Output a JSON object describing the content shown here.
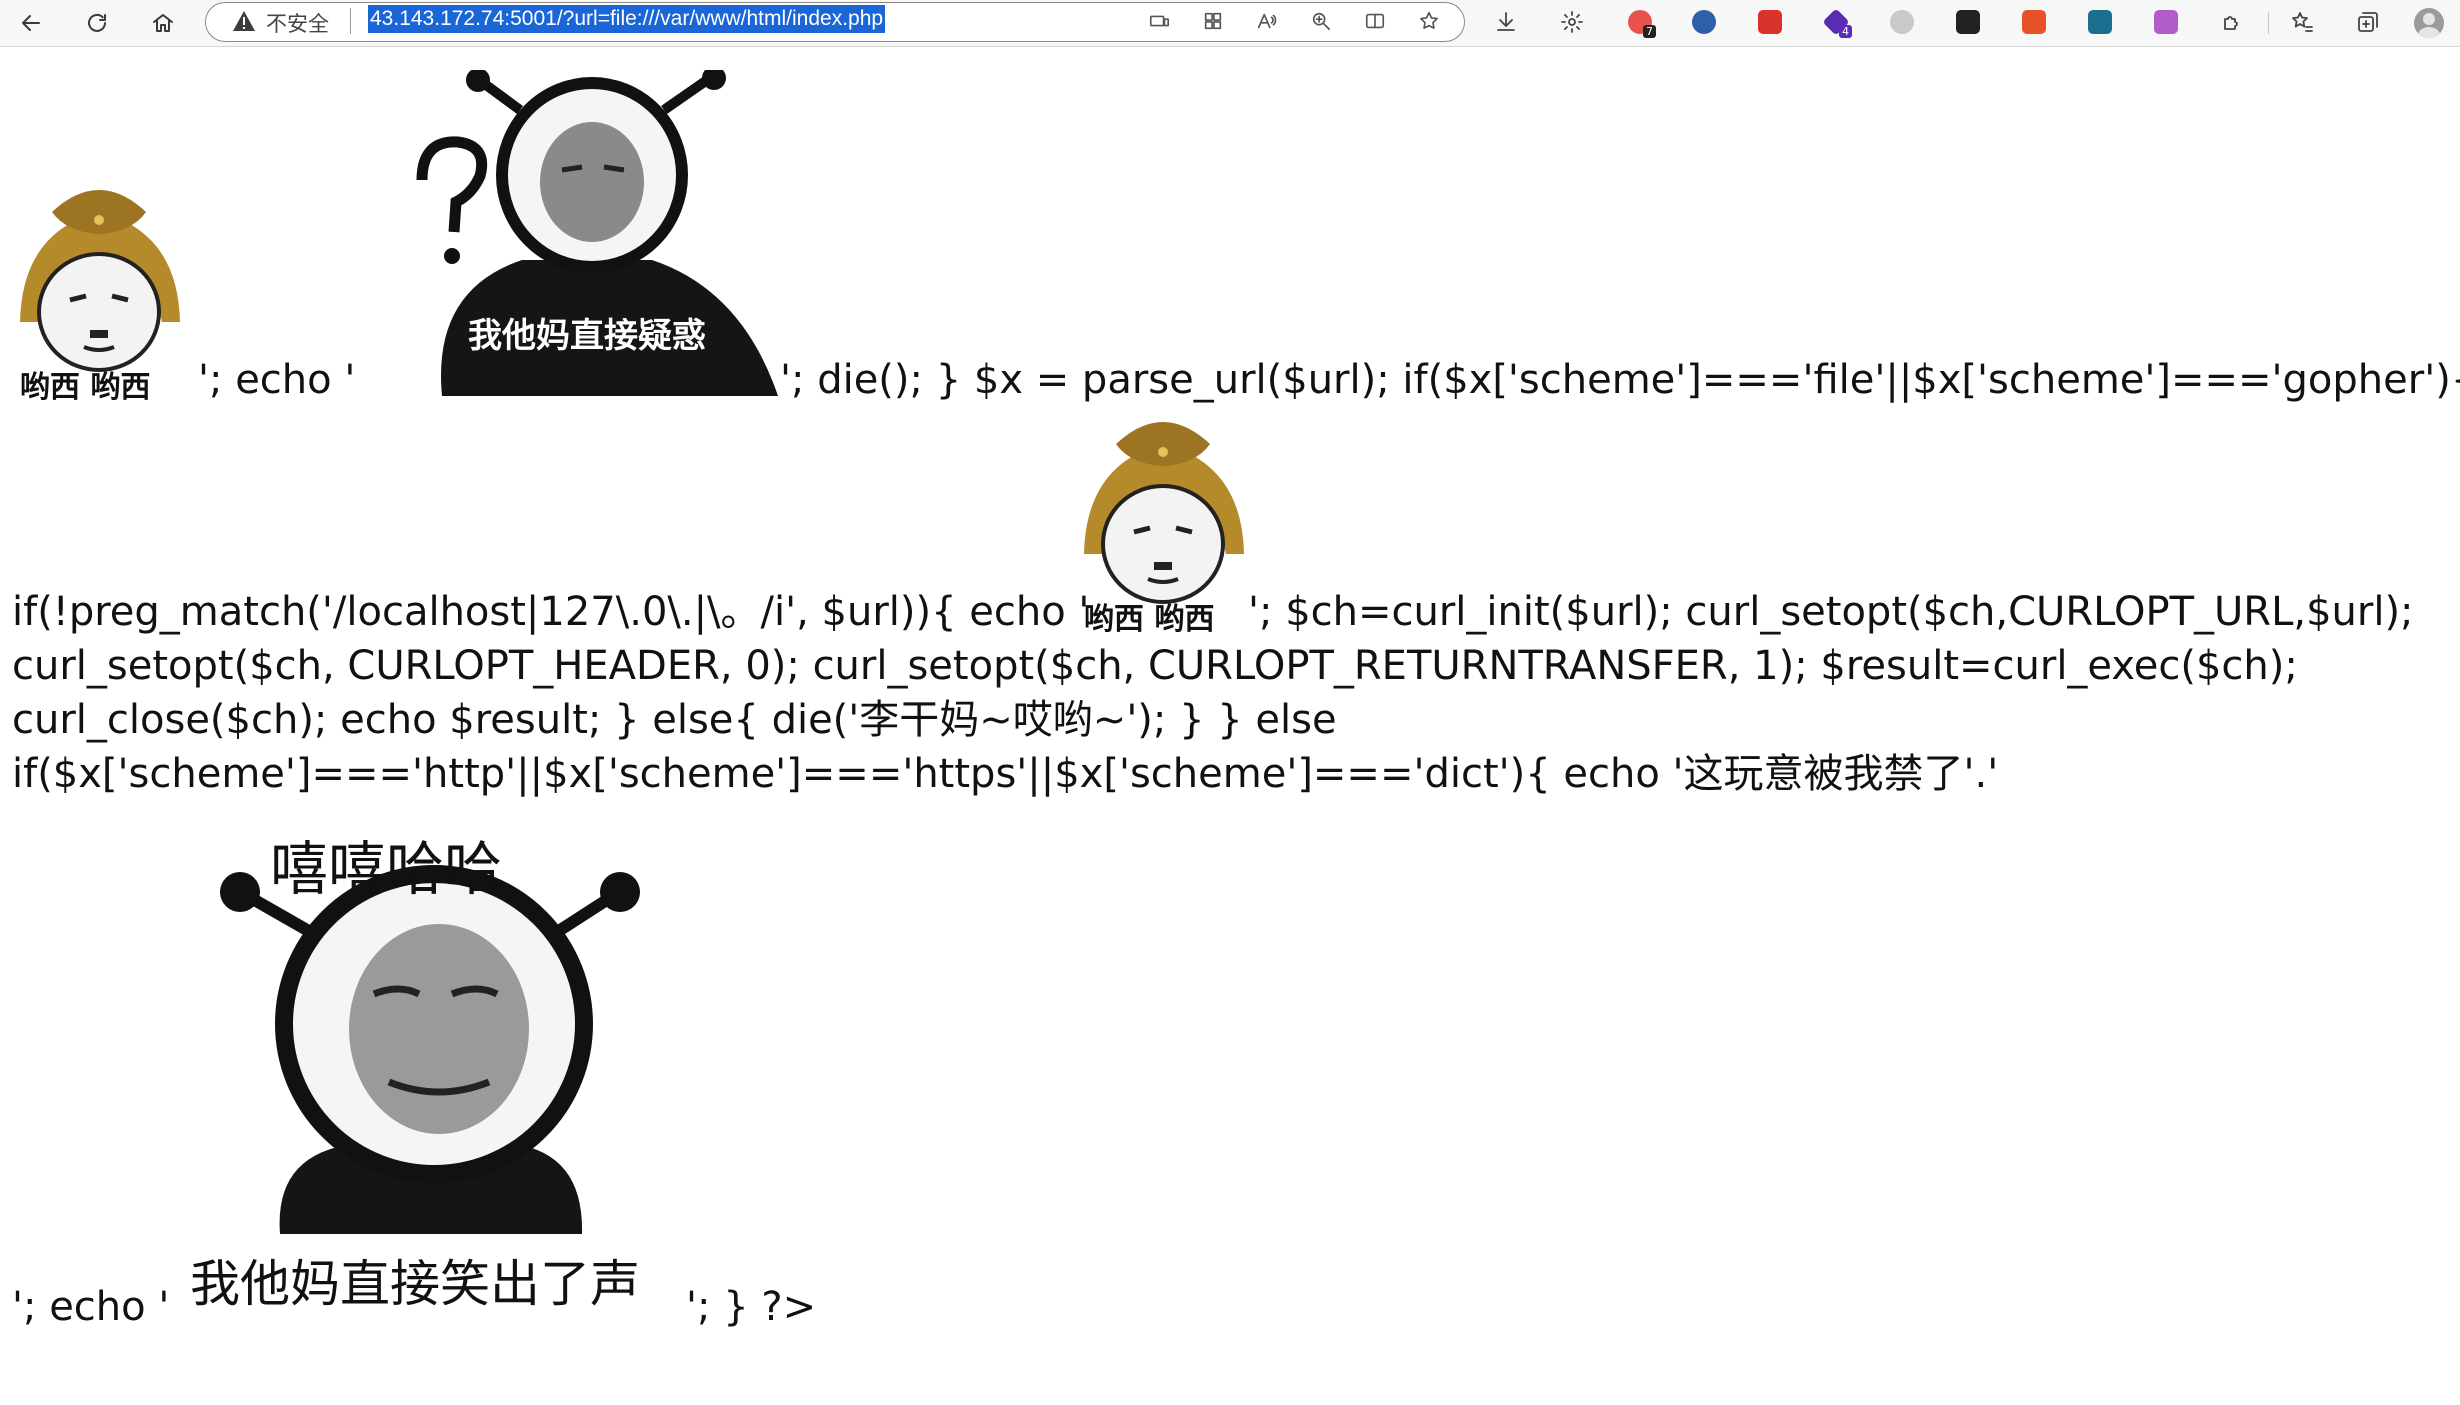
{
  "browser": {
    "security_label": "不安全",
    "url": "43.143.172.74:5001/?url=file:///var/www/html/index.php",
    "extension_badges": {
      "ext2": "7",
      "ext5": "4"
    },
    "colors": {
      "url_highlight": "#1a66d6",
      "toolbar_bg": "#f7f7f7"
    }
  },
  "page": {
    "line1_seg1": "'; echo '",
    "line1_seg2": "'; die(); } $x = parse_url($url); if($x['scheme']==='file'||$x['scheme']==='gopher'){",
    "line2_seg1": "if(!preg_match('/localhost|127\\.0\\.|\\。/i', $url)){ echo '",
    "line2_seg2": "'; $ch=curl_init($url); curl_setopt($ch,CURLOPT_URL,$url);",
    "line3": "curl_setopt($ch, CURLOPT_HEADER, 0); curl_setopt($ch, CURLOPT_RETURNTRANSFER, 1); $result=curl_exec($ch);",
    "line4": "curl_close($ch); echo $result; } else{ die('李干妈~哎哟~'); } } else",
    "line5": "if($x['scheme']==='http'||$x['scheme']==='https'||$x['scheme']==='dict'){ echo '这玩意被我禁了'.'",
    "line6_seg1": "'; echo '",
    "line6_seg2": "'; } ?>"
  },
  "memes": {
    "soldier_caption": "哟西  哟西",
    "question_caption": "我他妈直接疑惑",
    "laugh_top_caption": "嘻嘻哈哈",
    "laugh_bottom_caption": "我他妈直接笑出了声"
  }
}
